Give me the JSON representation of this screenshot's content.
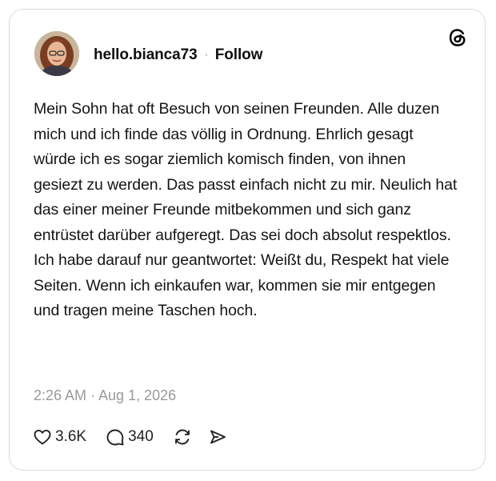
{
  "post": {
    "username": "hello.bianca73",
    "separator": "·",
    "follow_label": "Follow",
    "text": "Mein Sohn hat oft Besuch von seinen Freunden. Alle duzen mich und ich finde das völlig in Ordnung. Ehrlich gesagt würde ich es sogar ziemlich komisch finden, von ihnen gesiezt zu werden. Das passt einfach nicht zu mir. Neulich hat das einer meiner Freunde mitbekommen und sich ganz entrüstet darüber aufgeregt. Das sei doch absolut respektlos. Ich habe darauf nur geantwortet: Weißt du, Respekt hat viele Seiten. Wenn ich einkaufen war, kommen sie mir entgegen und tragen meine Taschen hoch.",
    "timestamp": "2:26 AM · Aug 1, 2026"
  },
  "actions": {
    "likes": "3.6K",
    "replies": "340"
  },
  "icons": {
    "brand": "threads-logo-icon",
    "like": "heart-icon",
    "reply": "comment-bubble-icon",
    "repost": "repost-icon",
    "share": "send-icon"
  },
  "colors": {
    "text": "#101010",
    "muted": "#9a9a9a",
    "border": "#dcdcdc",
    "background": "#ffffff"
  }
}
